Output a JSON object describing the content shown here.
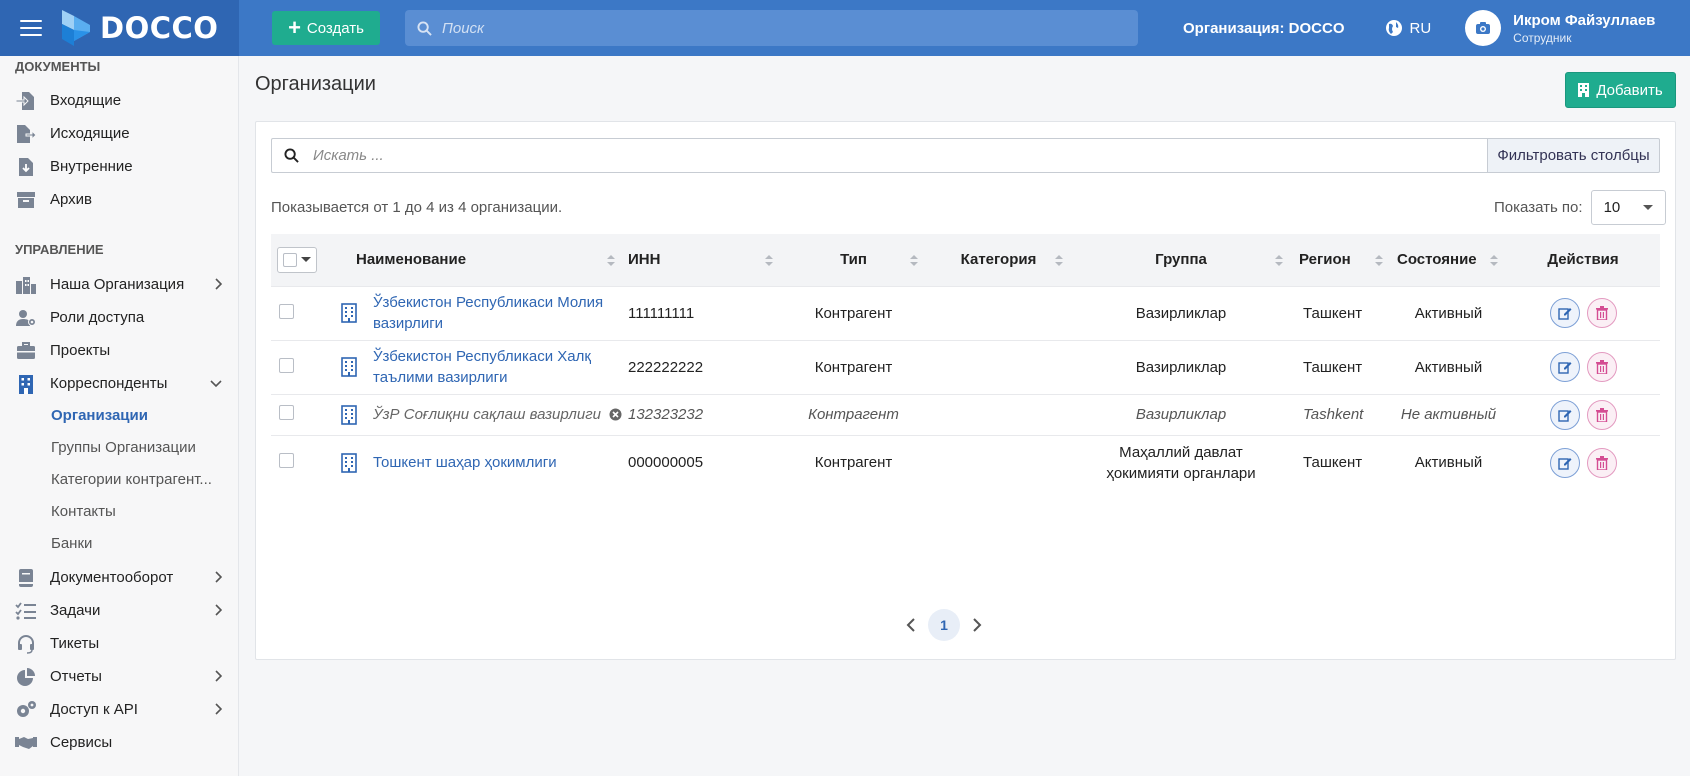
{
  "header": {
    "brand": "DOCCO",
    "create_label": "Создать",
    "search_placeholder": "Поиск",
    "organization_label": "Организация: DOCCO",
    "language": "RU",
    "user_name": "Икром Файзуллаев",
    "user_role": "Сотрудник"
  },
  "sidebar": {
    "documents_title": "ДОКУМЕНТЫ",
    "management_title": "УПРАВЛЕНИЕ",
    "documents": [
      {
        "label": "Входящие",
        "icon": "inbox-doc-icon"
      },
      {
        "label": "Исходящие",
        "icon": "outbox-doc-icon"
      },
      {
        "label": "Внутренние",
        "icon": "internal-doc-icon"
      },
      {
        "label": "Архив",
        "icon": "archive-icon"
      }
    ],
    "management": [
      {
        "label": "Наша Организация",
        "icon": "city-icon",
        "expand": "right"
      },
      {
        "label": "Роли доступа",
        "icon": "users-cog-icon"
      },
      {
        "label": "Проекты",
        "icon": "briefcase-icon"
      },
      {
        "label": "Корреспонденты",
        "icon": "building-icon",
        "expand": "down"
      }
    ],
    "sub_items": [
      "Организации",
      "Группы Организации",
      "Категории контрагент...",
      "Контакты",
      "Банки"
    ],
    "bottom": [
      {
        "label": "Документооборот",
        "icon": "book-icon",
        "expand": "right"
      },
      {
        "label": "Задачи",
        "icon": "tasks-icon",
        "expand": "right"
      },
      {
        "label": "Тикеты",
        "icon": "headset-icon"
      },
      {
        "label": "Отчеты",
        "icon": "pie-chart-icon",
        "expand": "right"
      },
      {
        "label": "Доступ к API",
        "icon": "cogs-icon",
        "expand": "right"
      },
      {
        "label": "Сервисы",
        "icon": "handshake-icon"
      }
    ]
  },
  "main": {
    "title": "Организации",
    "add_label": "Добавить",
    "search_placeholder": "Искать ...",
    "filter_label": "Фильтровать столбцы",
    "info": "Показывается от 1 до 4 из 4 организации.",
    "per_page_label": "Показать по:",
    "per_page_value": "10",
    "columns": [
      "Наименование",
      "ИНН",
      "Тип",
      "Категория",
      "Группа",
      "Регион",
      "Состояние",
      "Действия"
    ],
    "rows": [
      {
        "name": "Ўзбекистон Республикаси Молия вазирлиги",
        "inn": "111111111",
        "type": "Контрагент",
        "category": "",
        "group": "Вазирликлар",
        "region": "Ташкент",
        "status": "Активный",
        "active": true
      },
      {
        "name": "Ўзбекистон Республикаси Халқ таълими вазирлиги",
        "inn": "222222222",
        "type": "Контрагент",
        "category": "",
        "group": "Вазирликлар",
        "region": "Ташкент",
        "status": "Активный",
        "active": true
      },
      {
        "name": "ЎзР Соғлиқни сақлаш вазирлиги",
        "inn": "132323232",
        "type": "Контрагент",
        "category": "",
        "group": "Вазирликлар",
        "region": "Tashkent",
        "status": "Не активный",
        "active": false
      },
      {
        "name": "Тошкент шаҳар ҳокимлиги",
        "inn": "000000005",
        "type": "Контрагент",
        "category": "",
        "group": "Маҳаллий давлат ҳокимияти органлари",
        "region": "Ташкент",
        "status": "Активный",
        "active": true
      }
    ],
    "page": "1"
  },
  "colors": {
    "header_bg": "#3c78c6",
    "brand_bg": "#2f66b3",
    "accent_green": "#1fac8f",
    "link": "#2f66b3"
  }
}
